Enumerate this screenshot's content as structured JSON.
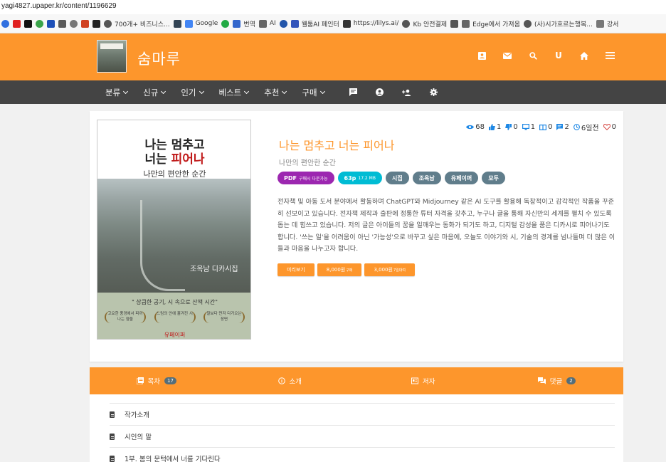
{
  "browser": {
    "url": "yagi4827.upaper.kr/content/1196629",
    "bookmarks": [
      {
        "label": "",
        "color": "#2f6fe0"
      },
      {
        "label": "",
        "color": "#e02020"
      },
      {
        "label": "",
        "color": "#111111"
      },
      {
        "label": "",
        "color": "#3aa34a"
      },
      {
        "label": "",
        "color": "#1d4fb8"
      },
      {
        "label": "",
        "color": "#5a5a5a"
      },
      {
        "label": "",
        "color": "#777777"
      },
      {
        "label": "",
        "color": "#d04020"
      },
      {
        "label": "",
        "color": "#222222"
      },
      {
        "label": "700개+ 비즈니스...",
        "color": "#555555"
      },
      {
        "label": "",
        "color": "#334455"
      },
      {
        "label": "Google",
        "color": "#4285f4"
      },
      {
        "label": "",
        "color": "#22aa44"
      },
      {
        "label": "번역",
        "color": "#3366cc"
      },
      {
        "label": "AI",
        "color": "#666666"
      },
      {
        "label": "",
        "color": "#2255aa"
      },
      {
        "label": "웰툼AI 페인터",
        "color": "#3355bb"
      },
      {
        "label": "https://lilys.ai/",
        "color": "#333333"
      },
      {
        "label": "Kb 안전결제",
        "color": "#555555"
      },
      {
        "label": "",
        "color": "#555555"
      },
      {
        "label": "Edge에서 가져옴",
        "color": "#666666"
      },
      {
        "label": "(사)시가흐르는행복...",
        "color": "#555555"
      },
      {
        "label": "강서",
        "color": "#777777"
      }
    ]
  },
  "site": {
    "name": "숨마루",
    "header_icons": [
      "account-box-icon",
      "mail-icon",
      "search-icon",
      "user-initial-icon",
      "home-icon",
      "menu-icon"
    ],
    "user_initial": "U"
  },
  "nav": {
    "items": [
      "분류",
      "신규",
      "인기",
      "베스트",
      "추천",
      "구매"
    ],
    "icons": [
      "chat-icon",
      "user-circle-icon",
      "add-user-icon",
      "settings-icon"
    ]
  },
  "book": {
    "cover": {
      "line1": "나는 멈추고",
      "line2_prefix": "너는 ",
      "line2_red": "피어나",
      "subtitle": "나만의 편안한 순간",
      "poet": "조옥남 디카시집",
      "quote": "\" 상큼한 공기,  시 속으로 산책 시간\"",
      "laurels": [
        "고요한 풍경에서 피어나는 향울",
        "느림의 안에 흘겨진 시",
        "말보다 먼저 다가오는 장면"
      ],
      "publisher": "유페이퍼"
    },
    "stats": {
      "views": "68",
      "likes": "1",
      "dislikes": "0",
      "screens": "1",
      "books": "0",
      "comments": "2",
      "date": "6일전",
      "hearts": "0"
    },
    "title": "나는 멈추고 너는 피어나",
    "subtitle": "나만의 편안한 순간",
    "tags": {
      "pdf": "PDF",
      "pdf_small": "구매시 다운가능",
      "pages": "63p",
      "pages_small": "17.2 MB",
      "genre": "시집",
      "author": "조옥남",
      "publisher": "유페이퍼",
      "audience": "모두"
    },
    "description": "전자책 및 아동 도서 분야에서 활동하며 ChatGPT와 Midjourney 같은 AI 도구를 활용해 독창적이고 감각적인 작품을 꾸준히 선보이고 있습니다. 전자책 제작과 출판에 정통한 튜터 자격을 갖추고, 누구나 글을 통해 자신만의 세계를 펼치 수 있도록 돕는 데 힘쓰고 있습니다. 저의 글은 아이들의 꿈을 일깨우는 동화가 되기도 하고, 디지털 감성을 품은 디카시로 피어나기도 합니다. '쓰는 일'을 어려움이 아닌 '가능성'으로 바꾸고 싶은 마음에, 오늘도 이야기와 시, 기술의 경계를 넘나들며 더 많은 이들과 마음을 나누고자 합니다.",
    "actions": {
      "preview": "미리보기",
      "buy": "8,000원",
      "buy_small": "구매",
      "rent": "3,000원",
      "rent_small": "7일대여"
    }
  },
  "tabs": [
    {
      "label": "목차",
      "badge": "17",
      "icon": "toc-icon"
    },
    {
      "label": "소개",
      "badge": "",
      "icon": "info-icon"
    },
    {
      "label": "저자",
      "badge": "",
      "icon": "author-icon"
    },
    {
      "label": "댓글",
      "badge": "2",
      "icon": "comment-icon"
    }
  ],
  "toc": [
    "작가소개",
    "시인의 말",
    "1부. 봄의 문턱에서 너를 기다린다"
  ],
  "colors": {
    "brand": "#fd962c",
    "nav": "#444444",
    "accent_blue": "#1e88e5",
    "tag_pdf": "#9c27b0",
    "tag_pages": "#00bcd4",
    "tag_gray": "#607d8b"
  }
}
